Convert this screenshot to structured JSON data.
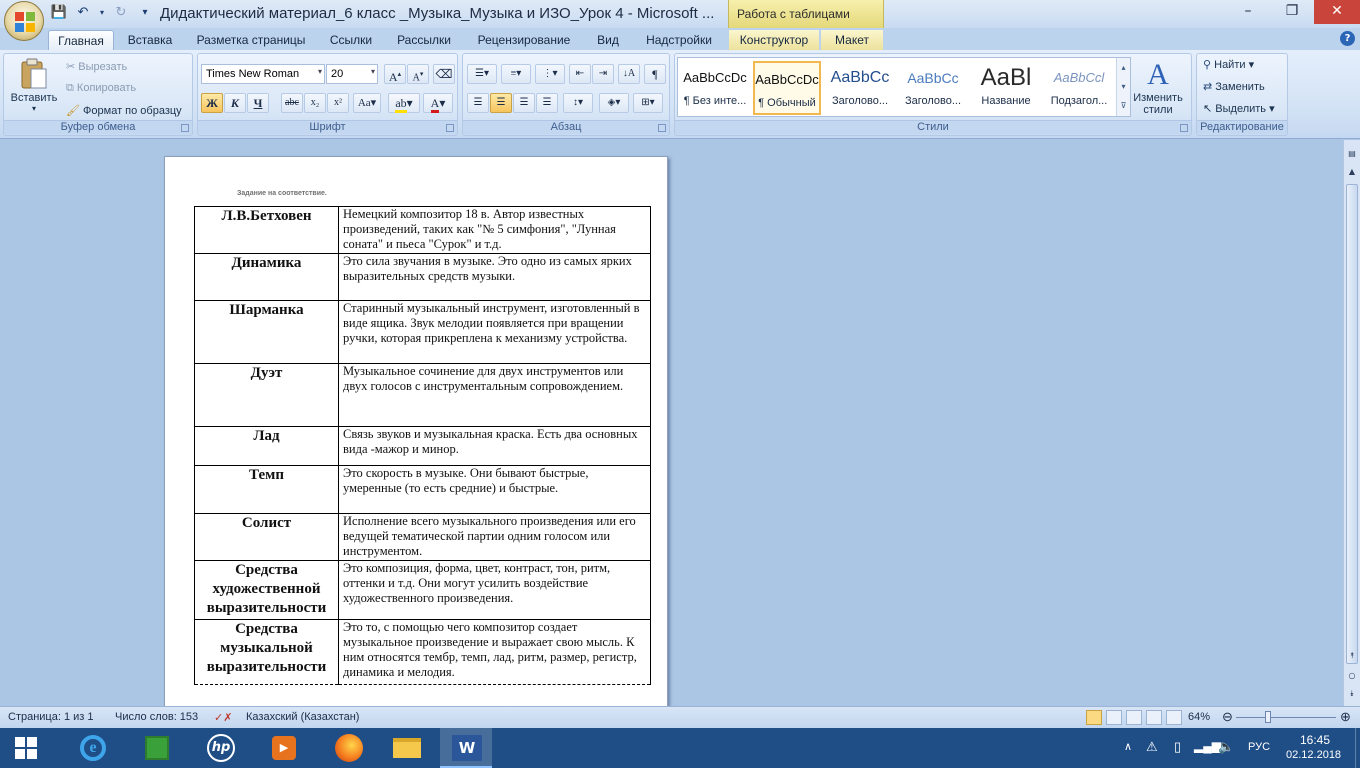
{
  "window": {
    "title": "Дидактический материал_6 класс _Музыка_Музыка и ИЗО_Урок 4 - Microsoft ...",
    "context_tab_title": "Работа с таблицами",
    "minimize": "–",
    "maximize": "❐",
    "close": "✕"
  },
  "tabs": [
    "Главная",
    "Вставка",
    "Разметка страницы",
    "Ссылки",
    "Рассылки",
    "Рецензирование",
    "Вид",
    "Надстройки",
    "Конструктор",
    "Макет"
  ],
  "ribbon": {
    "clipboard": {
      "label": "Буфер обмена",
      "paste": "Вставить",
      "cut": "Вырезать",
      "copy": "Копировать",
      "format_painter": "Формат по образцу"
    },
    "font": {
      "label": "Шрифт",
      "font_name": "Times New Roman",
      "font_size": "20"
    },
    "paragraph": {
      "label": "Абзац"
    },
    "styles": {
      "label": "Стили",
      "items": [
        {
          "sample": "AaBbCcDc",
          "name": "¶ Без инте..."
        },
        {
          "sample": "AaBbCcDc",
          "name": "¶ Обычный"
        },
        {
          "sample": "AaBbCc",
          "name": "Заголово..."
        },
        {
          "sample": "AaBbCc",
          "name": "Заголово..."
        },
        {
          "sample": "AaBl",
          "name": "Название"
        },
        {
          "sample": "AaBbCcl",
          "name": "Подзагол..."
        }
      ],
      "change_styles": "Изменить стили"
    },
    "editing": {
      "label": "Редактирование",
      "find": "Найти",
      "replace": "Заменить",
      "select": "Выделить"
    }
  },
  "document": {
    "task_title": "Задание на соответствие.",
    "rows": [
      {
        "term": "Л.В.Бетховен",
        "desc": "Немецкий композитор 18 в. Автор известных произведений, таких как \"№ 5 симфония\", \"Лунная соната\" и пьеса \"Сурок\" и т.д."
      },
      {
        "term": "Динамика",
        "desc": "Это сила звучания в музыке. Это  одно из самых ярких выразительных средств музыки."
      },
      {
        "term": "Шарманка",
        "desc": "Старинный музыкальный инструмент, изготовленный в виде ящика. Звук мелодии появляется при вращении ручки, которая прикреплена к механизму устройства."
      },
      {
        "term": "Дуэт",
        "desc": "Музыкальное сочинение для двух инструментов или двух голосов с инструментальным сопровождением."
      },
      {
        "term": "Лад",
        "desc": "Связь звуков и музыкальная краска. Есть два основных вида -мажор и минор."
      },
      {
        "term": "Темп",
        "desc": "Это скорость в музыке. Они бывают быстрые, умеренные (то есть средние) и быстрые."
      },
      {
        "term": "Солист",
        "desc": "Исполнение всего музыкального произведения или его ведущей тематической партии одним голосом или инструментом."
      },
      {
        "term": "Средства художественной выразительности",
        "desc": "Это композиция, форма, цвет, контраст, тон, ритм, оттенки и т.д. Они могут  усилить воздействие художественного произведения."
      },
      {
        "term": "Средства музыкальной выразительности",
        "desc": "Это то, с помощью чего композитор создает музыкальное произведение и выражает свою мысль. К ним относятся  тембр, темп, лад, ритм, размер, регистр, динамика и мелодия."
      }
    ]
  },
  "statusbar": {
    "page": "Страница: 1 из 1",
    "words": "Число слов: 153",
    "language": "Казахский (Казахстан)",
    "zoom": "64%"
  },
  "taskbar": {
    "language": "РУС",
    "time": "16:45",
    "date": "02.12.2018"
  }
}
